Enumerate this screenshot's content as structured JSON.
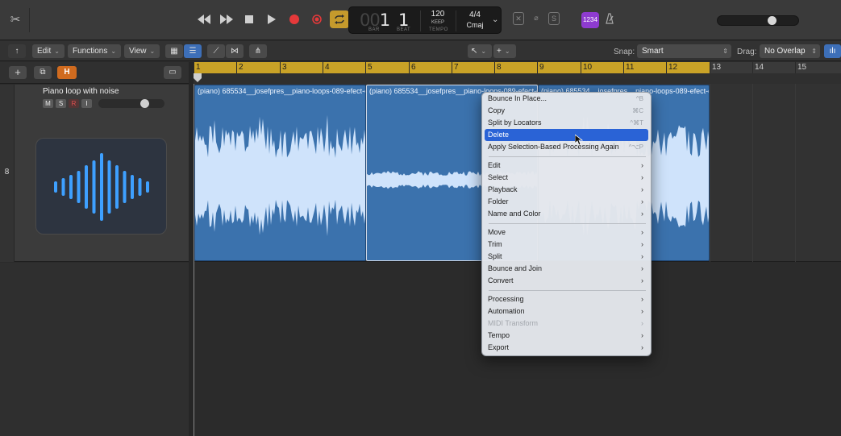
{
  "transport": {
    "bar_dim": "00",
    "bar": "1",
    "beat": "1",
    "bar_label": "BAR",
    "beat_label": "BEAT",
    "tempo": "120",
    "tempo_mode": "KEEP",
    "tempo_label": "TEMPO",
    "time_signature": "4/4",
    "key": "Cmaj",
    "counter_badge": "1234"
  },
  "toolbar": {
    "edit_label": "Edit",
    "functions_label": "Functions",
    "view_label": "View",
    "snap_label": "Snap:",
    "snap_value": "Smart",
    "drag_label": "Drag:",
    "drag_value": "No Overlap"
  },
  "track_header": {
    "h_button": "H"
  },
  "track": {
    "number": "8",
    "name": "Piano loop with noise",
    "mute": "M",
    "solo": "S",
    "record": "R",
    "input": "I",
    "volume": 0.65
  },
  "ruler": {
    "bars": [
      "1",
      "2",
      "3",
      "4",
      "5",
      "6",
      "7",
      "8",
      "9",
      "10",
      "11",
      "12",
      "13",
      "14",
      "15"
    ]
  },
  "regions": [
    {
      "title": "(piano) 685534__josefpres__piano-loops-089-efect-o"
    },
    {
      "title": "(piano) 685534__josefpres__piano-loops-089-efect-o"
    },
    {
      "title": "(piano) 685534__josefpres__piano-loops-089-efect-o"
    }
  ],
  "context_menu": {
    "items": [
      {
        "label": "Bounce In Place...",
        "shortcut": "^B"
      },
      {
        "label": "Copy",
        "shortcut": "⌘C"
      },
      {
        "label": "Split by Locators",
        "shortcut": "^⌘T"
      },
      {
        "label": "Delete",
        "shortcut": ""
      },
      {
        "label": "Apply Selection-Based Processing Again",
        "shortcut": "^⌥P"
      },
      {
        "label": "Edit"
      },
      {
        "label": "Select"
      },
      {
        "label": "Playback"
      },
      {
        "label": "Folder"
      },
      {
        "label": "Name and Color"
      },
      {
        "label": "Move"
      },
      {
        "label": "Trim"
      },
      {
        "label": "Split"
      },
      {
        "label": "Bounce and Join"
      },
      {
        "label": "Convert"
      },
      {
        "label": "Processing"
      },
      {
        "label": "Automation"
      },
      {
        "label": "MIDI Transform"
      },
      {
        "label": "Tempo"
      },
      {
        "label": "Export"
      }
    ]
  },
  "colors": {
    "region": "#3b72ad",
    "ruler_cycle": "#c9a227",
    "menu_highlight": "#2a63d6",
    "loop_button": "#c59a2c",
    "h_button": "#d06b1f",
    "counter_badge": "#8e3bd0"
  },
  "icons": {
    "scissors": "scissors-icon",
    "rewind": "rewind-icon",
    "forward": "fast-forward-icon",
    "stop": "stop-icon",
    "play": "play-icon",
    "record": "record-icon",
    "loop": "loop-icon",
    "metronome": "metronome-icon",
    "waveform": "waveform-icon"
  }
}
